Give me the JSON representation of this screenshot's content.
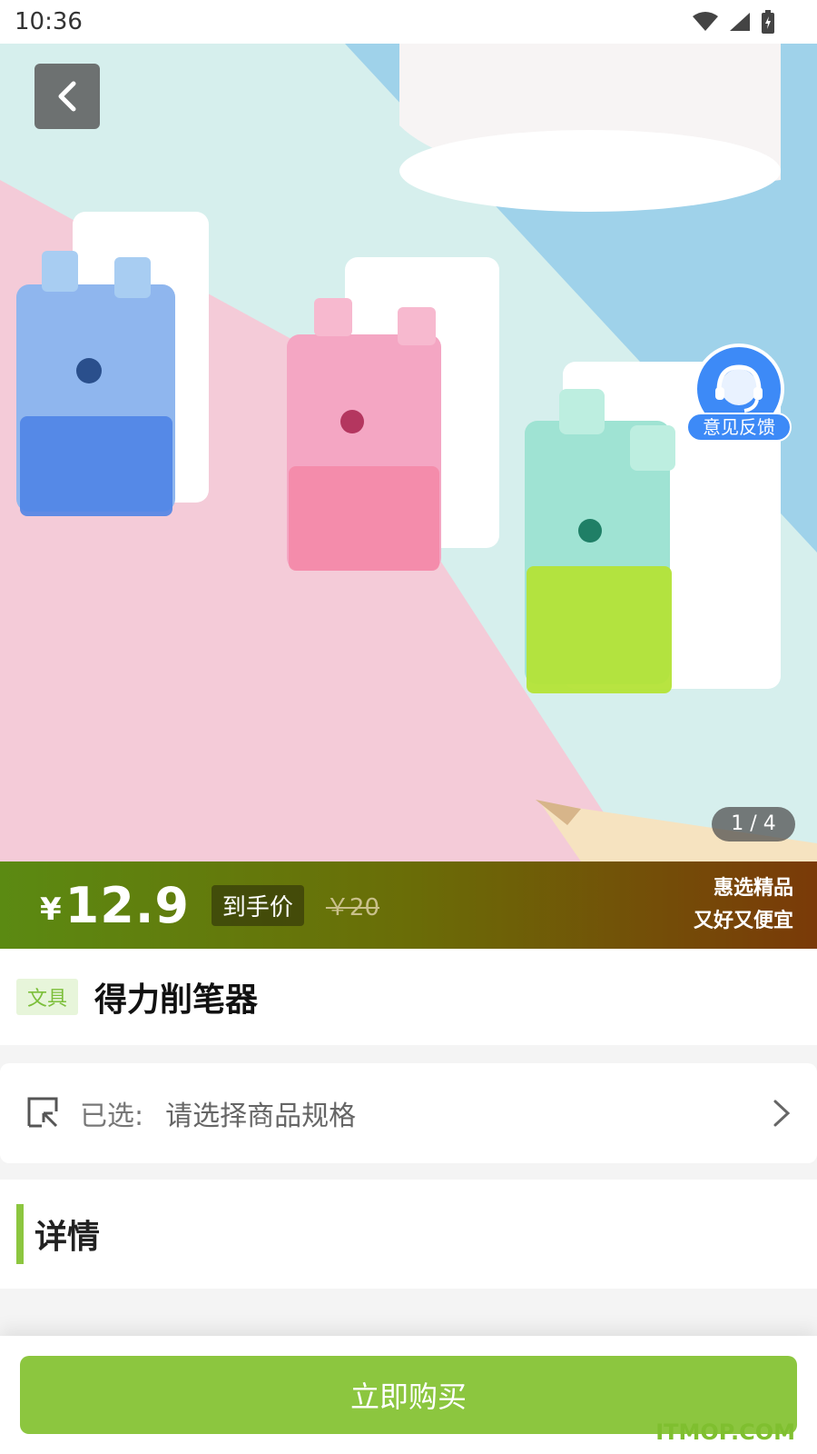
{
  "status_bar": {
    "time": "10:36"
  },
  "hero": {
    "page_indicator": "1 / 4",
    "feedback_label": "意见反馈"
  },
  "price": {
    "symbol": "¥",
    "value": "12.9",
    "tag": "到手价",
    "original": "￥20",
    "promo_line1": "惠选精品",
    "promo_line2": "又好又便宜"
  },
  "product": {
    "category": "文具",
    "title": "得力削笔器"
  },
  "spec": {
    "label": "已选:",
    "value": "请选择商品规格"
  },
  "details": {
    "title": "详情"
  },
  "bottom": {
    "buy_label": "立即购买",
    "watermark": "ITMOP.COM"
  },
  "colors": {
    "accent": "#8cc63f",
    "feedback_blue": "#3d8af7"
  }
}
